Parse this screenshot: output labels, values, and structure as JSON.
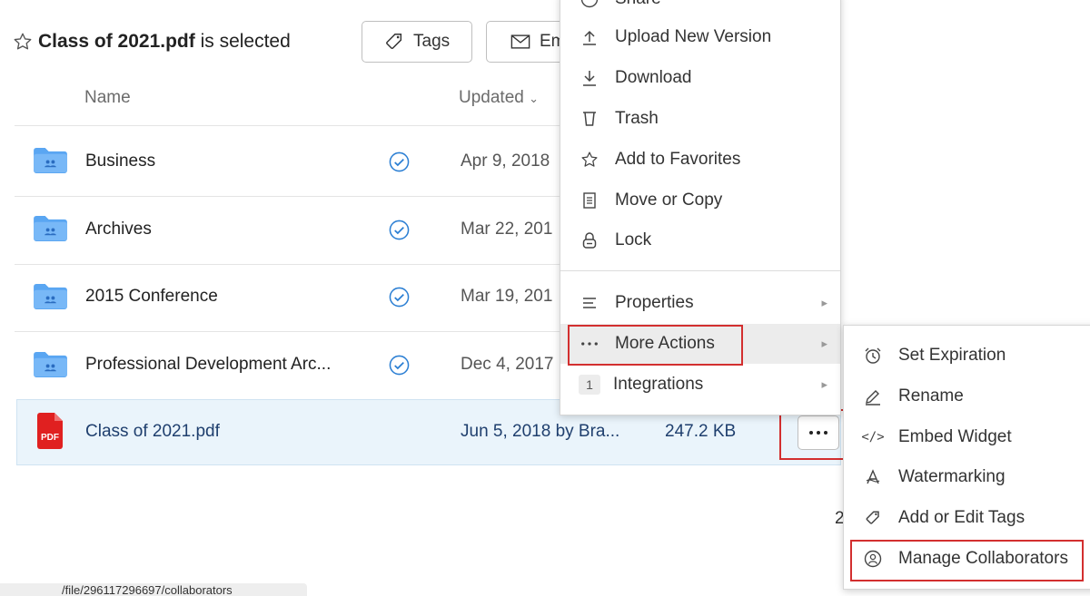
{
  "header": {
    "selected_file": "Class of 2021.pdf",
    "selected_suffix": " is selected"
  },
  "toolbar": {
    "tags_label": "Tags",
    "email_label": "Em"
  },
  "columns": {
    "name": "Name",
    "updated": "Updated"
  },
  "rows": [
    {
      "name": "Business",
      "updated": "Apr 9, 2018"
    },
    {
      "name": "Archives",
      "updated": "Mar 22, 201"
    },
    {
      "name": "2015 Conference",
      "updated": "Mar 19, 201"
    },
    {
      "name": "Professional Development Arc...",
      "updated": "Dec 4, 2017"
    }
  ],
  "selected_row": {
    "name": "Class of 2021.pdf",
    "updated": "Jun 5, 2018 by Bra...",
    "size": "247.2 KB",
    "pdf_badge": "PDF"
  },
  "main_menu": {
    "partial_top": "Share",
    "items": [
      "Upload New Version",
      "Download",
      "Trash",
      "Add to Favorites",
      "Move or Copy",
      "Lock"
    ],
    "properties": "Properties",
    "more_actions": "More Actions",
    "integrations": "Integrations",
    "integrations_count": "1"
  },
  "sub_menu": {
    "items": [
      "Set Expiration",
      "Rename",
      "Embed Widget",
      "Watermarking",
      "Add or Edit Tags",
      "Manage Collaborators"
    ]
  },
  "page_partial_number": "2",
  "status_url": "/file/296117296697/collaborators",
  "colors": {
    "accent": "#2a7ed3",
    "folder": "#5aa6f2",
    "pdf_red": "#e02020",
    "highlight": "#d32f2f",
    "selected_row_bg": "#eaf4fb"
  }
}
